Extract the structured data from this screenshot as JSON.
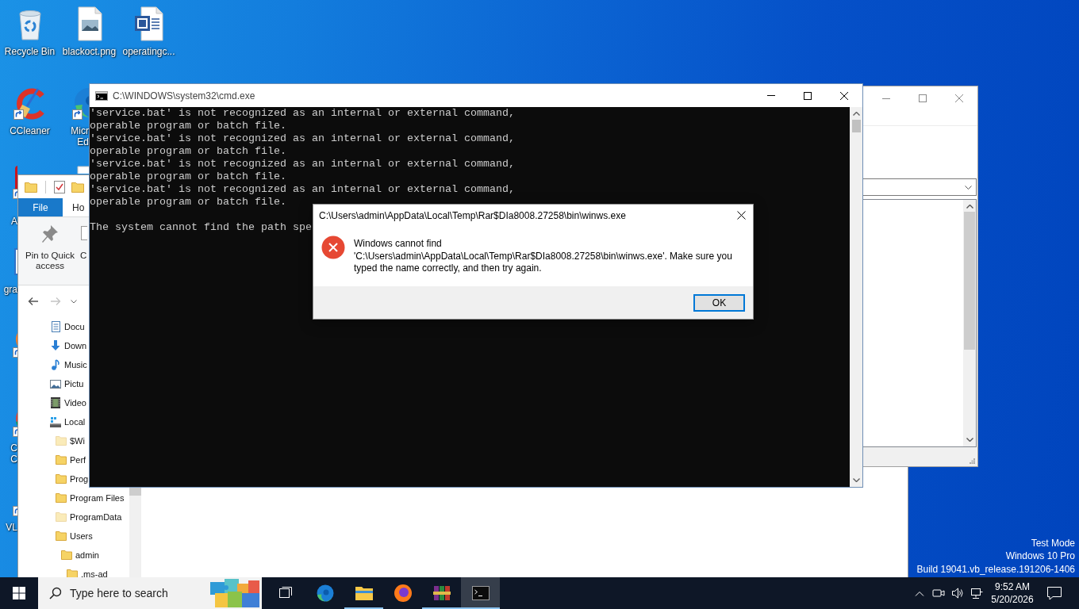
{
  "desktop": {
    "icons": [
      {
        "kind": "recycle-bin",
        "label": [
          "Recycle Bin"
        ]
      },
      {
        "kind": "image-file",
        "label": [
          "blackoct.png"
        ]
      },
      {
        "kind": "word-document",
        "label": [
          "operatingc..."
        ]
      },
      {
        "kind": "ccleaner",
        "label": [
          "CCleaner"
        ]
      },
      {
        "kind": "edge",
        "label": [
          "Micr",
          "Ed"
        ]
      },
      {
        "kind": "red-app",
        "label": [
          "A"
        ]
      },
      {
        "kind": "document"
      },
      {
        "kind": "blue-app",
        "label": [
          "gra"
        ]
      },
      {
        "kind": "firefox"
      },
      {
        "kind": "chrome",
        "label": [
          "C",
          "C"
        ]
      },
      {
        "kind": "vlc",
        "label": [
          "VL"
        ]
      }
    ],
    "notice": [
      "Test Mode",
      "Windows 10 Pro",
      "Build 19041.vb_release.191206-1406"
    ]
  },
  "explorer": {
    "ribbon_tabs": [
      {
        "kind": "file-menu",
        "label": "File"
      },
      {
        "kind": "tab",
        "label": "Ho"
      }
    ],
    "ribbon_buttons": [
      {
        "kind": "pin",
        "label": "Pin to Quick access"
      },
      {
        "kind": "copy",
        "label": "C"
      }
    ],
    "history_buttons": [
      {
        "kind": "back",
        "disabled": false
      },
      {
        "kind": "forward",
        "disabled": true
      }
    ],
    "nav_tree": [
      {
        "kind": "documents",
        "label": "Docu",
        "hidden": false
      },
      {
        "kind": "downloads",
        "label": "Down",
        "hidden": false
      },
      {
        "kind": "music",
        "label": "Music",
        "hidden": false
      },
      {
        "kind": "pictures",
        "label": "Pictu",
        "hidden": false
      },
      {
        "kind": "videos",
        "label": "Video",
        "hidden": false
      },
      {
        "kind": "drive",
        "label": "Local",
        "hidden": false,
        "children": [
          {
            "kind": "folder",
            "label": "$Wi",
            "hidden": true
          },
          {
            "kind": "folder",
            "label": "Perf",
            "hidden": false
          },
          {
            "kind": "folder",
            "label": "Prog",
            "hidden": false
          },
          {
            "kind": "folder",
            "label": "Program Files",
            "hidden": false
          },
          {
            "kind": "folder",
            "label": "ProgramData",
            "hidden": true
          },
          {
            "kind": "folder",
            "label": "Users",
            "hidden": false,
            "children": [
              {
                "kind": "folder",
                "label": "admin",
                "hidden": false,
                "children": [
                  {
                    "kind": "folder",
                    "label": ".ms-ad",
                    "hidden": false
                  }
                ]
              }
            ]
          }
        ]
      }
    ]
  },
  "console": {
    "title": "C:\\WINDOWS\\system32\\cmd.exe",
    "output_blocks": [
      [
        "'service.bat' is not recognized as an internal or external command,",
        "operable program or batch file.",
        "'service.bat' is not recognized as an internal or external command,",
        "operable program or batch file.",
        "'service.bat' is not recognized as an internal or external command,",
        "operable program or batch file.",
        "'service.bat' is not recognized as an internal or external command,",
        "operable program or batch file."
      ],
      [
        "The system cannot find the path spe"
      ]
    ]
  },
  "dialog": {
    "title": "C:\\Users\\admin\\AppData\\Local\\Temp\\Rar$DIa8008.27258\\bin\\winws.exe",
    "message": "Windows cannot find 'C:\\Users\\admin\\AppData\\Local\\Temp\\Rar$DIa8008.27258\\bin\\winws.exe'. Make sure you typed the name correctly, and then try again.",
    "buttons": [
      {
        "label": "OK",
        "focused": true
      }
    ]
  },
  "taskbar": {
    "search": {
      "placeholder": "Type here to search"
    },
    "apps": [
      {
        "kind": "task-view",
        "running": false,
        "selected": false
      },
      {
        "kind": "edge",
        "running": false,
        "selected": false
      },
      {
        "kind": "explorer",
        "running": true,
        "selected": false
      },
      {
        "kind": "firefox",
        "running": false,
        "selected": false
      },
      {
        "kind": "winrar",
        "running": true,
        "selected": false
      },
      {
        "kind": "cmd",
        "running": true,
        "selected": true
      }
    ],
    "clock": {
      "time": "9:52 AM",
      "date": "5/20/2026"
    }
  }
}
